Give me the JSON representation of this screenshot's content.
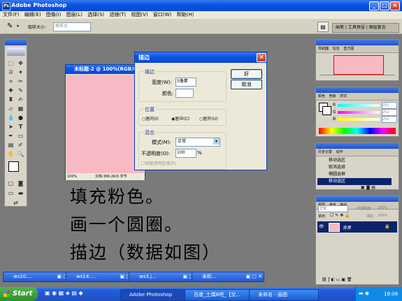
{
  "app": {
    "title": "Adobe Photoshop"
  },
  "menu": [
    "文件(F)",
    "编辑(E)",
    "图像(I)",
    "图层(L)",
    "选择(S)",
    "滤镜(T)",
    "视图(V)",
    "窗口(W)",
    "帮助(H)"
  ],
  "options_bar": {
    "brush_size_label": "取样大小:",
    "brush_size_value": "取样点"
  },
  "palette_well": {
    "tabs": [
      "画笔",
      "工具预设",
      "图层复合"
    ]
  },
  "document": {
    "title": "未标题-2 @ 100%(RGB/8)",
    "zoom": "100%",
    "doc_info": "文档:366.2K/0 字节",
    "canvas_color": "#f7b9c3"
  },
  "dialog": {
    "title": "描边",
    "ok": "好",
    "cancel": "取消",
    "stroke_group": "描边",
    "width_label": "宽度(W):",
    "width_value": "5像素",
    "color_label": "颜色:",
    "location_group": "位置",
    "location_options": [
      "居内(I)",
      "居中(C)",
      "居外(U)"
    ],
    "location_selected": "居中(C)",
    "blend_group": "混合",
    "mode_label": "模式(M):",
    "mode_value": "正常",
    "opacity_label": "不透明度(O):",
    "opacity_value": "100",
    "opacity_unit": "%",
    "preserve_label": "保留透明区域(P)"
  },
  "navigator": {
    "tabs": [
      "导航器",
      "信息",
      "直方图"
    ]
  },
  "color_palette": {
    "tabs": [
      "颜色",
      "色板",
      "样式"
    ],
    "channels": [
      "R",
      "G",
      "B"
    ],
    "values": [
      "252",
      "252",
      "252"
    ]
  },
  "history": {
    "tabs": [
      "历史记录",
      "动作"
    ],
    "items": [
      "移动选区",
      "取消选择",
      "椭圆选框",
      "移动选区"
    ]
  },
  "layers": {
    "tabs": [
      "图层",
      "通道",
      "路径"
    ],
    "blend_mode": "正常",
    "opacity_label": "不透明度:",
    "opacity_value": "100%",
    "lock_label": "锁定:",
    "fill_label": "填充:",
    "fill_value": "100%",
    "layer_name": "背景"
  },
  "lesson_text": [
    "填充粉色。",
    "画一个圆圈。",
    "描边（数据如图）"
  ],
  "minimized_windows": [
    "ws10....",
    "ws14....",
    "ws3.j...",
    "未标..."
  ],
  "taskbar": {
    "start": "Start",
    "items": [
      "Adobe Photoshop",
      "百度_土偶8吧_【交...",
      "未命名 - 画图"
    ],
    "time": "18:08"
  }
}
